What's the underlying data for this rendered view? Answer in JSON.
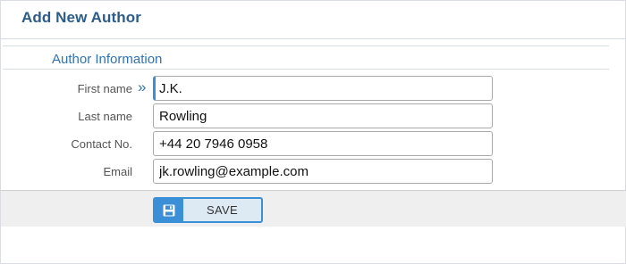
{
  "header": {
    "title": "Add New Author"
  },
  "section": {
    "title": "Author Information"
  },
  "form": {
    "fields": [
      {
        "label": "First name",
        "value": "J.K.",
        "focused": true,
        "icon": "double-chevron-right-icon"
      },
      {
        "label": "Last name",
        "value": "Rowling"
      },
      {
        "label": "Contact No.",
        "value": "+44 20 7946 0958"
      },
      {
        "label": "Email",
        "value": "jk.rowling@example.com"
      }
    ]
  },
  "footer": {
    "save_label": "SAVE",
    "save_icon": "floppy-disk-icon"
  },
  "colors": {
    "title": "#2b5d8a",
    "accent": "#3b8fd6",
    "section_title": "#2f74b5",
    "footer_bg": "#efefef"
  }
}
